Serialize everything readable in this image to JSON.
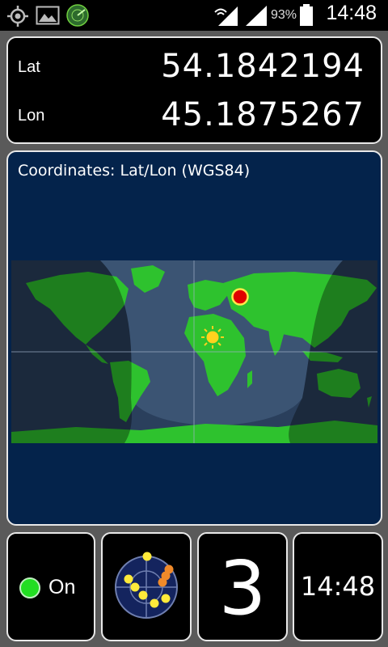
{
  "status_bar": {
    "icons": [
      "gps-crosshair-icon",
      "gallery-icon",
      "radar-app-icon",
      "wifi-icon",
      "signal-icon",
      "battery-icon"
    ],
    "battery_percent": "93%",
    "time": "14:48"
  },
  "coordinates": {
    "lat_label": "Lat",
    "lat_value": "54.1842194",
    "lon_label": "Lon",
    "lon_value": "45.1875267"
  },
  "map": {
    "title": "Coordinates: Lat/Lon (WGS84)",
    "position_marker": {
      "lat": 54.1842194,
      "lon": 45.1875267
    },
    "sun_marker_icon": "sun-icon"
  },
  "tiles": {
    "gps_status_label": "On",
    "gps_status_color": "#22dd22",
    "satellite_count": "3",
    "clock": "14:48"
  },
  "colors": {
    "map_background": "#04234b",
    "land": "#2ec22e",
    "position_marker": "#e00000",
    "sun": "#ffd21e"
  }
}
